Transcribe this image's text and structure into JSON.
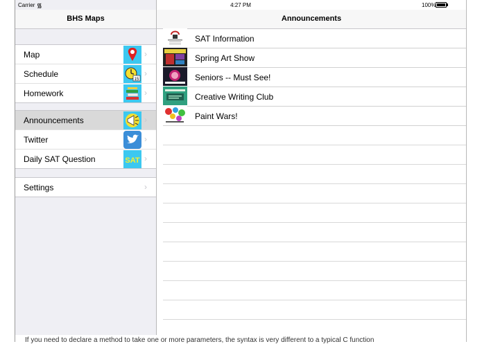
{
  "status": {
    "carrier": "Carrier",
    "time": "4:27 PM",
    "battery": "100%",
    "battery_level": 1.0
  },
  "master": {
    "title": "BHS Maps",
    "groups": [
      [
        {
          "label": "Map",
          "icon": "map-pin-icon"
        },
        {
          "label": "Schedule",
          "icon": "clock-icon"
        },
        {
          "label": "Homework",
          "icon": "books-icon"
        }
      ],
      [
        {
          "label": "Announcements",
          "icon": "megaphone-icon",
          "selected": true
        },
        {
          "label": "Twitter",
          "icon": "twitter-bird-icon"
        },
        {
          "label": "Daily SAT Question",
          "icon": "sat-icon",
          "icon_text": "SAT"
        }
      ],
      [
        {
          "label": "Settings"
        }
      ]
    ]
  },
  "detail": {
    "title": "Announcements",
    "items": [
      {
        "title": "SAT Information",
        "icon": "sat-poster-thumbnail"
      },
      {
        "title": "Spring Art Show",
        "icon": "art-show-thumbnail"
      },
      {
        "title": "Seniors --  Must See!",
        "icon": "seniors-thumbnail"
      },
      {
        "title": "Creative Writing Club",
        "icon": "writing-club-thumbnail"
      },
      {
        "title": "Paint Wars!",
        "icon": "paint-wars-thumbnail"
      }
    ]
  },
  "background_text": "If you need to declare a method to take one or more parameters, the syntax is very different to a typical C function",
  "colors": {
    "icon_bg": "#3cc8f0",
    "selected_row": "#d9d9d9",
    "sidebar_bg": "#efeff4"
  }
}
